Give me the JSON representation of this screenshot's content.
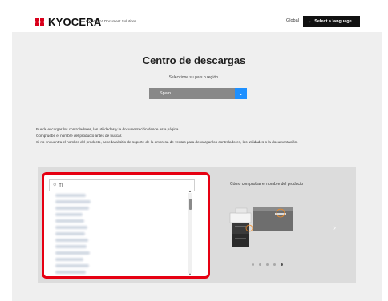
{
  "header": {
    "logo_text": "KYOCERA",
    "logo_subtitle": "KYOCERA Document Solutions",
    "global_link": "Global",
    "language_button": "Select a language"
  },
  "page": {
    "title": "Centro de descargas",
    "subtitle": "Seleccione su país o región.",
    "region_select_value": "Spain"
  },
  "info": {
    "line1": "Puede escargar los controladores, las utilidades y la documentación desde esta página.",
    "line2": "Compruebe el nombre del producto antes de buscar.",
    "line3": "Si no encuentra el nombre del producto, acceda al sitio de soporte de la empresa de ventas para descargar los controladores, las utilidades o la documentación."
  },
  "search": {
    "value": "T|",
    "results": [
      "",
      "",
      "",
      "",
      "",
      "",
      "",
      "",
      "",
      "",
      "",
      "",
      ""
    ]
  },
  "help": {
    "title": "Cómo comprobar el nombre del producto"
  },
  "carousel": {
    "dot_count": 5,
    "active_index": 4
  },
  "colors": {
    "brand_red": "#e60012",
    "accent_blue": "#1e90ff"
  }
}
